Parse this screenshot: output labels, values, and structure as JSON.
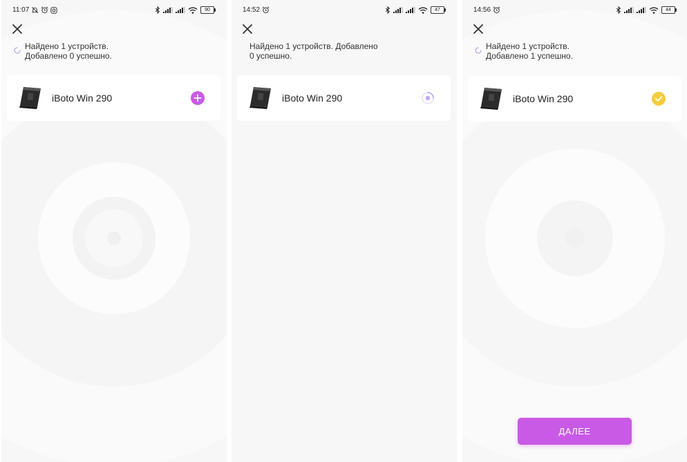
{
  "colors": {
    "accent": "#c95ae6",
    "success": "#f5cd3c",
    "progress": "#b9a6ee",
    "background": "#f7f7f7",
    "card": "#ffffff"
  },
  "screens": [
    {
      "status_bar": {
        "time": "11:07",
        "icons": [
          "mute-bell-icon",
          "alarm-icon",
          "instagram-icon"
        ],
        "battery": "90"
      },
      "status_text": "Найдено 1 устройств. Добавлено 0 успешно.",
      "status_lines": [
        "Найдено 1 устройств.",
        "Добавлено 0 успешно."
      ],
      "show_spinner": true,
      "device": {
        "name": "iBoto Win 290",
        "state": "add",
        "action_icon": "add-icon"
      },
      "next_button": null
    },
    {
      "status_bar": {
        "time": "14:52",
        "icons": [
          "alarm-icon"
        ],
        "battery": "47"
      },
      "status_lines": [
        "Найдено 1 устройств. Добавлено",
        "0 успешно."
      ],
      "show_spinner": false,
      "device": {
        "name": "iBoto Win 290",
        "state": "adding",
        "action_icon": "progress-ring-icon"
      },
      "next_button": null
    },
    {
      "status_bar": {
        "time": "14:56",
        "icons": [
          "alarm-icon"
        ],
        "battery": "44"
      },
      "status_lines": [
        "Найдено 1 устройств.",
        "Добавлено 1 успешно."
      ],
      "show_spinner": true,
      "device": {
        "name": "iBoto Win 290",
        "state": "added",
        "action_icon": "check-icon"
      },
      "next_button": {
        "label": "ДАЛЕЕ"
      }
    }
  ]
}
